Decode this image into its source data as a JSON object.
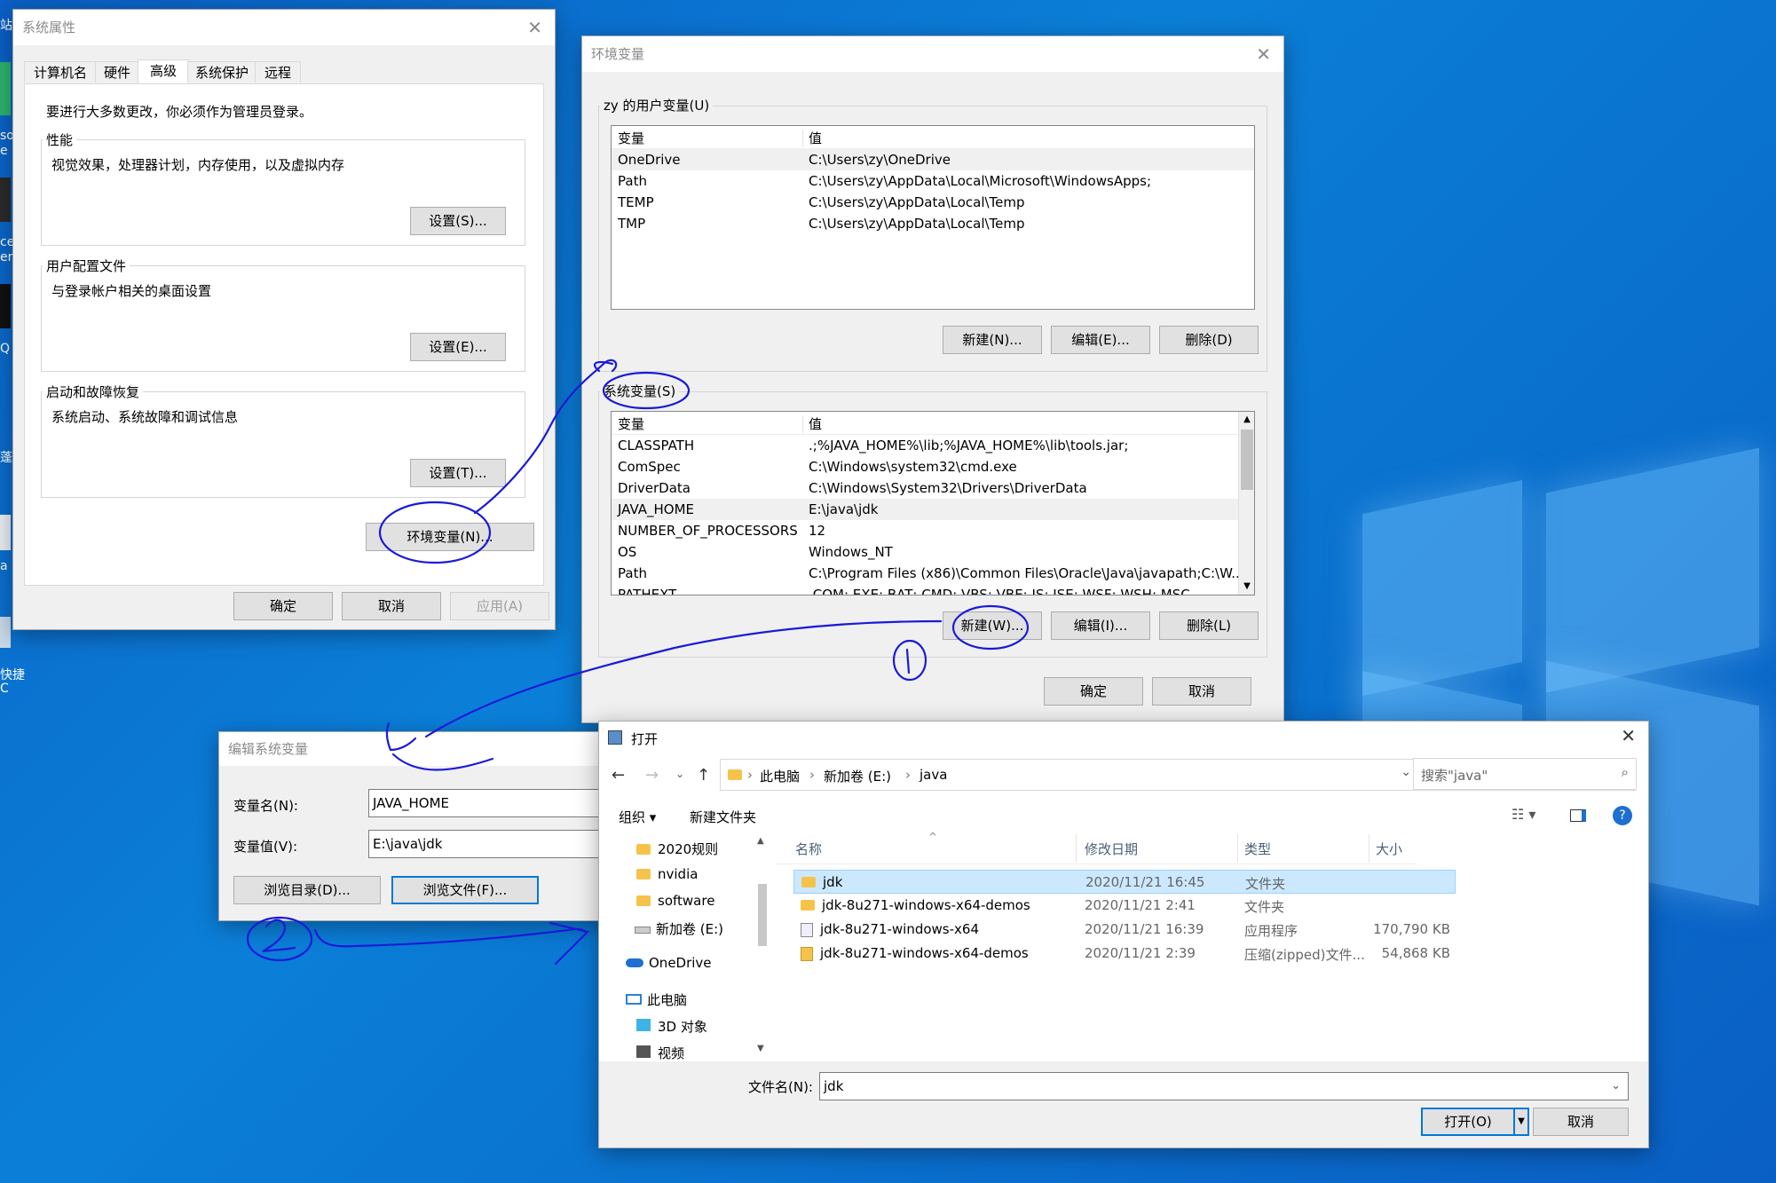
{
  "desktop": {
    "left_labels": [
      "站",
      "so",
      "e",
      "ce",
      "en",
      "Q",
      "蓬",
      "a",
      "快捷",
      "C"
    ]
  },
  "sysprops": {
    "title": "系统属性",
    "tabs": [
      "计算机名",
      "硬件",
      "高级",
      "系统保护",
      "远程"
    ],
    "admin_note": "要进行大多数更改，你必须作为管理员登录。",
    "perf_label": "性能",
    "perf_desc": "视觉效果，处理器计划，内存使用，以及虚拟内存",
    "perf_btn": "设置(S)...",
    "profile_label": "用户配置文件",
    "profile_desc": "与登录帐户相关的桌面设置",
    "profile_btn": "设置(E)...",
    "startup_label": "启动和故障恢复",
    "startup_desc": "系统启动、系统故障和调试信息",
    "startup_btn": "设置(T)...",
    "env_btn": "环境变量(N)...",
    "ok": "确定",
    "cancel": "取消",
    "apply": "应用(A)"
  },
  "envvars": {
    "title": "环境变量",
    "user_group": "zy 的用户变量(U)",
    "col_var": "变量",
    "col_val": "值",
    "user_vars": [
      {
        "name": "OneDrive",
        "value": "C:\\Users\\zy\\OneDrive"
      },
      {
        "name": "Path",
        "value": "C:\\Users\\zy\\AppData\\Local\\Microsoft\\WindowsApps;"
      },
      {
        "name": "TEMP",
        "value": "C:\\Users\\zy\\AppData\\Local\\Temp"
      },
      {
        "name": "TMP",
        "value": "C:\\Users\\zy\\AppData\\Local\\Temp"
      }
    ],
    "user_new": "新建(N)...",
    "user_edit": "编辑(E)...",
    "user_delete": "删除(D)",
    "sys_group": "系统变量(S)",
    "sys_vars": [
      {
        "name": "CLASSPATH",
        "value": ".;%JAVA_HOME%\\lib;%JAVA_HOME%\\lib\\tools.jar;"
      },
      {
        "name": "ComSpec",
        "value": "C:\\Windows\\system32\\cmd.exe"
      },
      {
        "name": "DriverData",
        "value": "C:\\Windows\\System32\\Drivers\\DriverData"
      },
      {
        "name": "JAVA_HOME",
        "value": "E:\\java\\jdk"
      },
      {
        "name": "NUMBER_OF_PROCESSORS",
        "value": "12"
      },
      {
        "name": "OS",
        "value": "Windows_NT"
      },
      {
        "name": "Path",
        "value": "C:\\Program Files (x86)\\Common Files\\Oracle\\Java\\javapath;C:\\W..."
      },
      {
        "name": "PATHEXT",
        "value": ".COM;.EXE;.BAT;.CMD;.VBS;.VBE;.JS;.JSE;.WSF;.WSH;.MSC"
      }
    ],
    "sys_new": "新建(W)...",
    "sys_edit": "编辑(I)...",
    "sys_delete": "删除(L)",
    "ok": "确定",
    "cancel": "取消"
  },
  "editvar": {
    "title": "编辑系统变量",
    "name_label": "变量名(N):",
    "name_value": "JAVA_HOME",
    "value_label": "变量值(V):",
    "value_value": "E:\\java\\jdk",
    "browse_dir": "浏览目录(D)...",
    "browse_file": "浏览文件(F)..."
  },
  "opendlg": {
    "title": "打开",
    "breadcrumb": [
      "此电脑",
      "新加卷 (E:)",
      "java"
    ],
    "search_placeholder": "搜索\"java\"",
    "organize": "组织 ▾",
    "new_folder": "新建文件夹",
    "nav_items": [
      "2020规则",
      "nvidia",
      "software",
      "新加卷 (E:)",
      "OneDrive",
      "此电脑",
      "3D 对象",
      "视频"
    ],
    "col_name": "名称",
    "col_date": "修改日期",
    "col_type": "类型",
    "col_size": "大小",
    "files": [
      {
        "name": "jdk",
        "date": "2020/11/21 16:45",
        "type": "文件夹",
        "size": ""
      },
      {
        "name": "jdk-8u271-windows-x64-demos",
        "date": "2020/11/21 2:41",
        "type": "文件夹",
        "size": ""
      },
      {
        "name": "jdk-8u271-windows-x64",
        "date": "2020/11/21 16:39",
        "type": "应用程序",
        "size": "170,790 KB"
      },
      {
        "name": "jdk-8u271-windows-x64-demos",
        "date": "2020/11/21 2:39",
        "type": "压缩(zipped)文件...",
        "size": "54,868 KB"
      }
    ],
    "filename_label": "文件名(N):",
    "filename_value": "jdk",
    "open_btn": "打开(O)",
    "cancel_btn": "取消"
  },
  "annotations": {
    "mark1": "1",
    "mark2": "2"
  }
}
